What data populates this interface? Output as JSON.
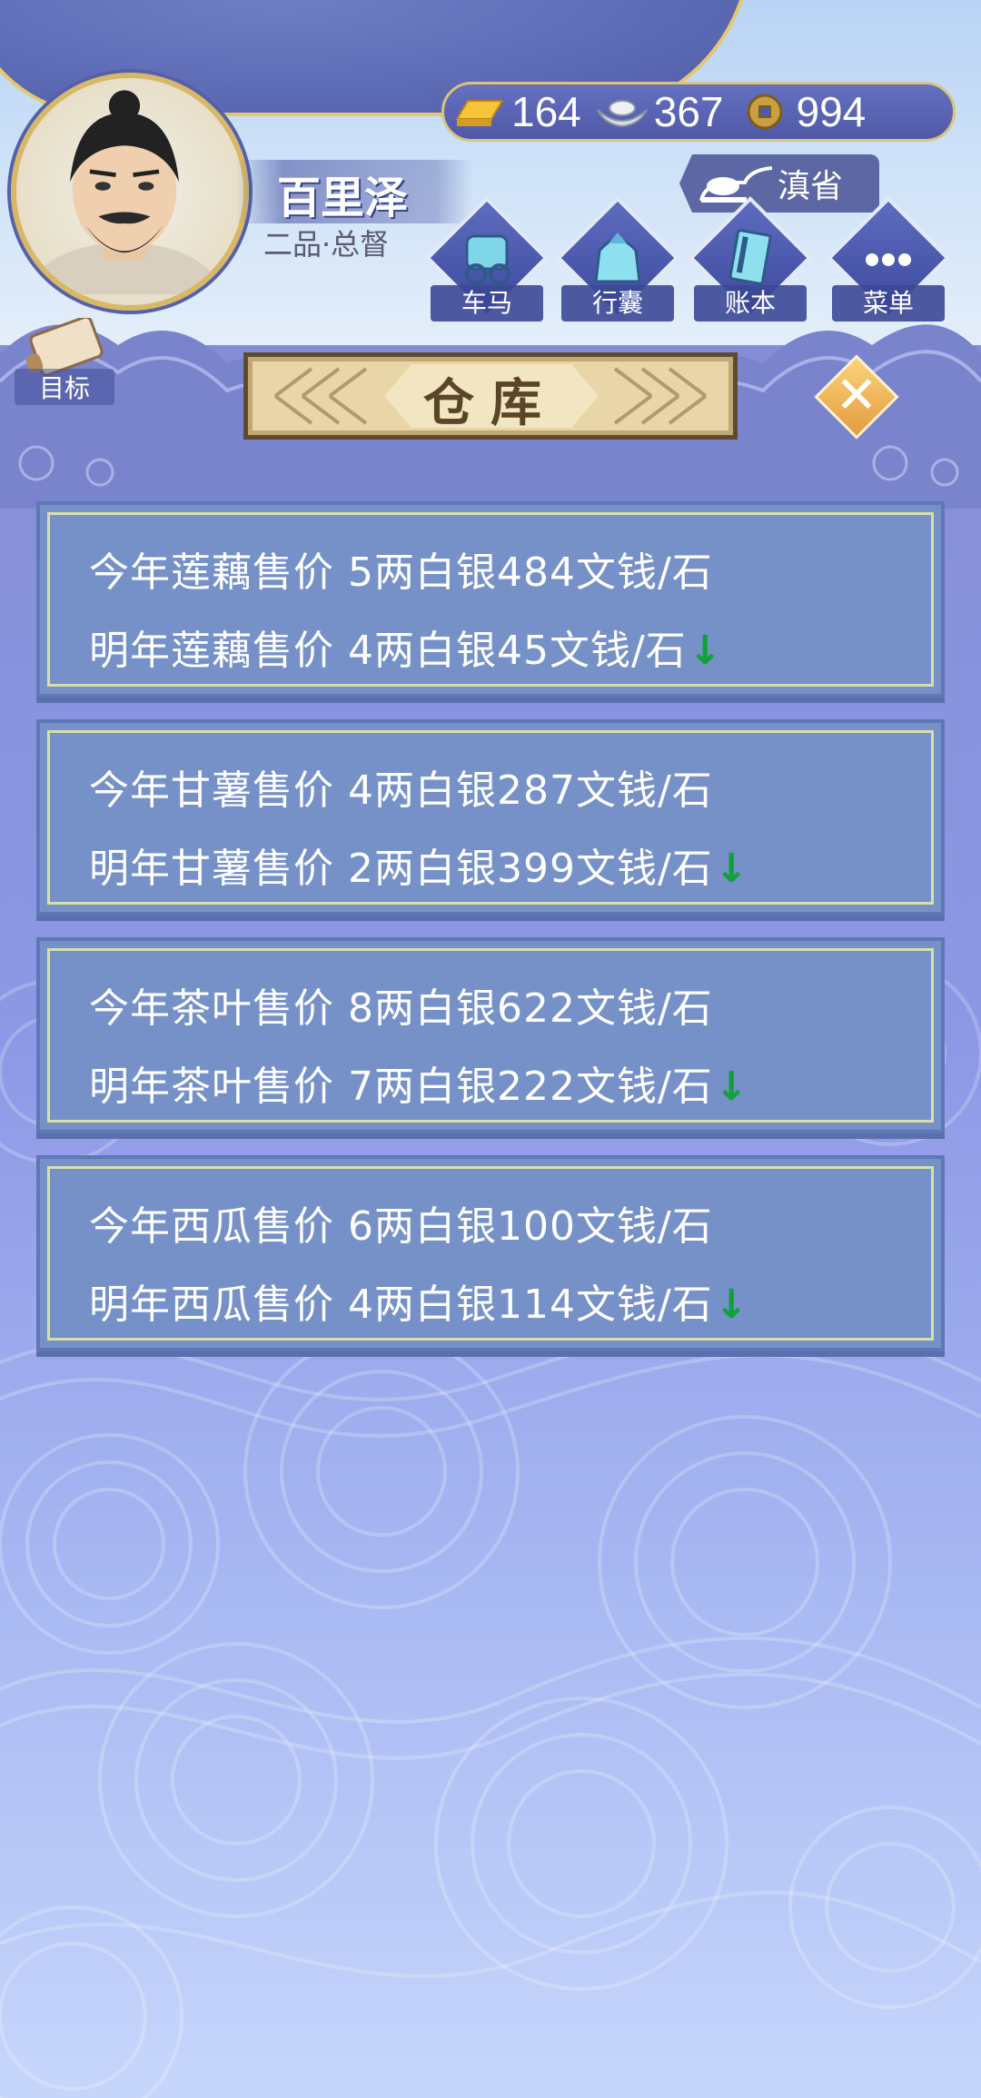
{
  "player": {
    "name": "百里泽",
    "rank": "二品·总督",
    "region": "滇省"
  },
  "resources": {
    "gold": "164",
    "silver": "367",
    "coin": "994"
  },
  "nav": {
    "carriage": "车马",
    "bag": "行囊",
    "ledger": "账本",
    "menu": "菜单",
    "goal": "目标"
  },
  "dialog": {
    "title": "仓库",
    "close_icon": "close-icon"
  },
  "prices": [
    {
      "this_year": "今年莲藕售价 5两白银484文钱/石",
      "next_year": "明年莲藕售价 4两白银45文钱/石",
      "trend": "↓"
    },
    {
      "this_year": "今年甘薯售价 4两白银287文钱/石",
      "next_year": "明年甘薯售价 2两白银399文钱/石",
      "trend": "↓"
    },
    {
      "this_year": "今年茶叶售价 8两白银622文钱/石",
      "next_year": "明年茶叶售价 7两白银222文钱/石",
      "trend": "↓"
    },
    {
      "this_year": "今年西瓜售价 6两白银100文钱/石",
      "next_year": "明年西瓜售价 4两白银114文钱/石",
      "trend": "↓"
    }
  ],
  "colors": {
    "trend_down": "#11a13a",
    "card_bg": "#7591c8",
    "accent_gold": "#d9c47a"
  }
}
